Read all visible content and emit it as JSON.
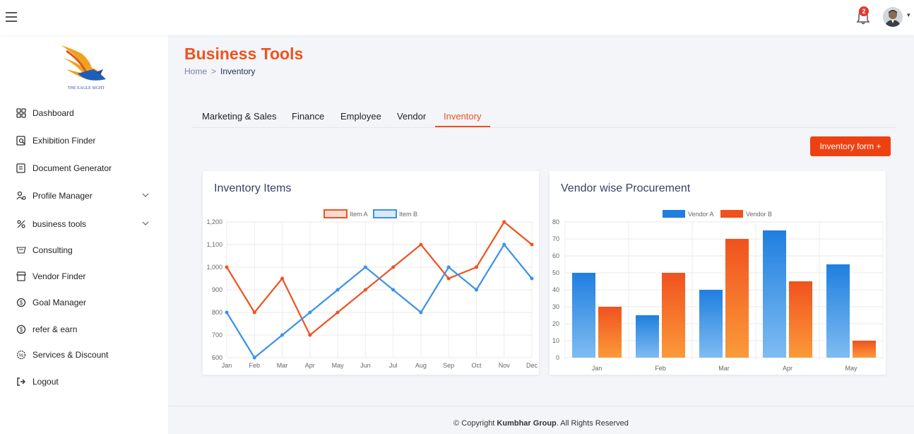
{
  "topbar": {
    "notification_count": "2",
    "caret": "▾"
  },
  "sidebar": {
    "logo_text": "THE EAGLE SIGHT",
    "items": [
      {
        "label": "Dashboard",
        "icon": "dashboard-icon"
      },
      {
        "label": "Exhibition Finder",
        "icon": "search-doc-icon"
      },
      {
        "label": "Document Generator",
        "icon": "document-icon"
      },
      {
        "label": "Profile Manager",
        "icon": "profile-icon",
        "expandable": true
      },
      {
        "label": "business tools",
        "icon": "tools-icon",
        "expandable": true
      },
      {
        "label": "Consulting",
        "icon": "consulting-icon"
      },
      {
        "label": "Vendor Finder",
        "icon": "vendor-icon"
      },
      {
        "label": "Goal Manager",
        "icon": "goal-icon"
      },
      {
        "label": "refer & earn",
        "icon": "refer-icon"
      },
      {
        "label": "Services & Discount",
        "icon": "discount-icon"
      },
      {
        "label": "Logout",
        "icon": "logout-icon"
      }
    ]
  },
  "header": {
    "title": "Business Tools",
    "breadcrumb": {
      "home": "Home",
      "separator": ">",
      "current": "Inventory"
    }
  },
  "tabs": [
    {
      "label": "Marketing & Sales",
      "active": false
    },
    {
      "label": "Finance",
      "active": false
    },
    {
      "label": "Employee",
      "active": false
    },
    {
      "label": "Vendor",
      "active": false
    },
    {
      "label": "Inventory",
      "active": true
    }
  ],
  "actions": {
    "inventory_form_label": "Inventory form +"
  },
  "chart_data": [
    {
      "type": "line",
      "title": "Inventory Items",
      "categories": [
        "Jan",
        "Feb",
        "Mar",
        "Apr",
        "May",
        "Jun",
        "Jul",
        "Aug",
        "Sep",
        "Oct",
        "Nov",
        "Dec"
      ],
      "series": [
        {
          "name": "Item A",
          "color": "#f0521e",
          "values": [
            1000,
            800,
            950,
            700,
            800,
            900,
            1000,
            1100,
            950,
            1000,
            1200,
            1100
          ]
        },
        {
          "name": "Item B",
          "color": "#3a92e8",
          "values": [
            800,
            600,
            700,
            800,
            900,
            1000,
            900,
            800,
            1000,
            900,
            1100,
            950
          ]
        }
      ],
      "ylim": [
        600,
        1200
      ],
      "yticks": [
        "600",
        "700",
        "800",
        "900",
        "1,000",
        "1,100",
        "1,200"
      ],
      "legend": "top",
      "grid": true
    },
    {
      "type": "bar",
      "title": "Vendor wise Procurement",
      "categories": [
        "Jan",
        "Feb",
        "Mar",
        "Apr",
        "May"
      ],
      "series": [
        {
          "name": "Vendor A",
          "color": "#1f7fe0",
          "values": [
            50,
            25,
            40,
            75,
            55
          ]
        },
        {
          "name": "Vendor B",
          "color": "#f0521e",
          "values": [
            30,
            50,
            70,
            45,
            10
          ]
        }
      ],
      "ylim": [
        0,
        80
      ],
      "yticks": [
        "0",
        "10",
        "20",
        "30",
        "40",
        "50",
        "60",
        "70",
        "80"
      ],
      "legend": "top",
      "grid": true
    }
  ],
  "footer": {
    "copyright_prefix": "© Copyright ",
    "company": "Kumbhar Group",
    "copyright_suffix": ". All Rights Reserved"
  }
}
